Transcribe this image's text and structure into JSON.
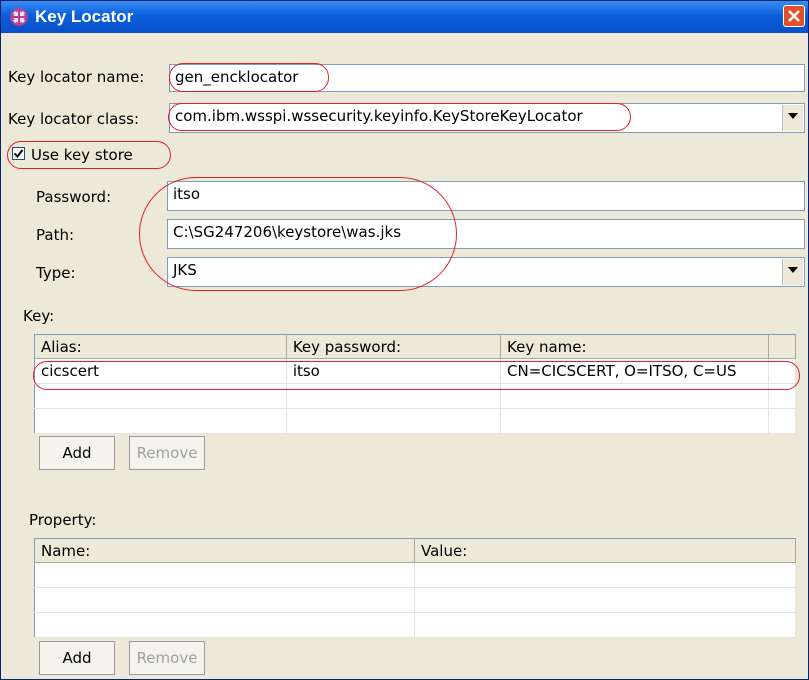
{
  "window": {
    "title": "Key Locator"
  },
  "fields": {
    "name_label": "Key locator name:",
    "name_value": "gen_encklocator",
    "class_label": "Key locator class:",
    "class_value": "com.ibm.wsspi.wssecurity.keyinfo.KeyStoreKeyLocator",
    "use_keystore_label": "Use key store",
    "use_keystore_checked": true,
    "password_label": "Password:",
    "password_value": "itso",
    "path_label": "Path:",
    "path_value": "C:\\SG247206\\keystore\\was.jks",
    "type_label": "Type:",
    "type_value": "JKS"
  },
  "key": {
    "section_label": "Key:",
    "columns": [
      "Alias:",
      "Key password:",
      "Key name:"
    ],
    "rows": [
      [
        "cicscert",
        "itso",
        "CN=CICSCERT, O=ITSO, C=US"
      ]
    ],
    "add_label": "Add",
    "remove_label": "Remove"
  },
  "property": {
    "section_label": "Property:",
    "columns": [
      "Name:",
      "Value:"
    ],
    "add_label": "Add",
    "remove_label": "Remove"
  },
  "colors": {
    "titlebar": "#0a5fdc",
    "annotation": "#e0202a",
    "dialog_bg": "#ece9d8"
  }
}
